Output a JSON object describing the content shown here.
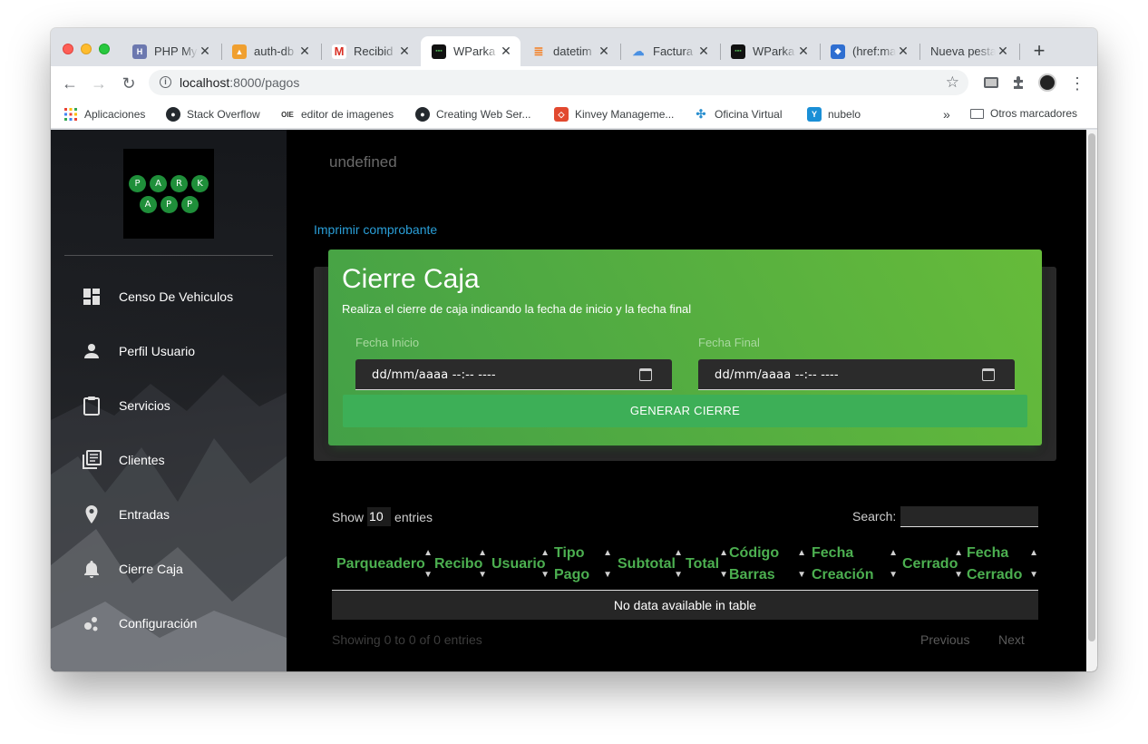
{
  "browser": {
    "tabs": [
      {
        "label": "PHP My",
        "icon": "phpmyadmin-favicon",
        "color": "#6c78af"
      },
      {
        "label": "auth-db",
        "icon": "pma-favicon",
        "color": "#f0a030"
      },
      {
        "label": "Recibid",
        "icon": "gmail-favicon",
        "color": "#d93025"
      },
      {
        "label": "WParka",
        "icon": "wparking-favicon",
        "color": "#1a1a1a"
      },
      {
        "label": "datetim",
        "icon": "stackoverflow-favicon",
        "color": "#f48024"
      },
      {
        "label": "Factura",
        "icon": "cloud-favicon",
        "color": "#4a90e2"
      },
      {
        "label": "WParka",
        "icon": "wparking-favicon",
        "color": "#1a1a1a"
      },
      {
        "label": "(href:ma",
        "icon": "shield-favicon",
        "color": "#2f6fd1"
      },
      {
        "label": "Nueva pesta",
        "icon": "none",
        "color": ""
      }
    ],
    "active_tab_index": 3,
    "new_tab_symbol": "+",
    "url_host": "localhost",
    "url_rest": ":8000/pagos",
    "bookmarks": [
      {
        "label": "Aplicaciones",
        "icon": "apps-grid-icon"
      },
      {
        "label": "Stack Overflow",
        "icon": "github-icon"
      },
      {
        "label": "editor de imagenes",
        "icon": "oie-icon",
        "icon_text": "OIE"
      },
      {
        "label": "Creating Web Ser...",
        "icon": "github-icon"
      },
      {
        "label": "Kinvey Manageme...",
        "icon": "kinvey-icon"
      },
      {
        "label": "Oficina Virtual",
        "icon": "slack-icon"
      },
      {
        "label": "nubelo",
        "icon": "nubelo-icon"
      }
    ],
    "bookmarks_overflow": "»",
    "other_bookmarks": "Otros marcadores"
  },
  "sidebar": {
    "logo_top": [
      "P",
      "A",
      "R",
      "K"
    ],
    "logo_bottom": [
      "A",
      "P",
      "P"
    ],
    "items": [
      {
        "label": "Censo De Vehiculos",
        "icon": "dashboard-icon"
      },
      {
        "label": "Perfil Usuario",
        "icon": "person-icon"
      },
      {
        "label": "Servicios",
        "icon": "clipboard-icon"
      },
      {
        "label": "Clientes",
        "icon": "library-books-icon"
      },
      {
        "label": "Entradas",
        "icon": "location-pin-icon"
      },
      {
        "label": "Cierre Caja",
        "icon": "bell-icon"
      },
      {
        "label": "Configuración",
        "icon": "bubble-chart-icon"
      }
    ]
  },
  "main": {
    "header_text": "undefined",
    "print_link": "Imprimir comprobante",
    "card": {
      "title": "Cierre Caja",
      "subtitle": "Realiza el cierre de caja indicando la fecha de inicio y la fecha final",
      "start_label": "Fecha Inicio",
      "end_label": "Fecha Final",
      "start_value": "dd/mm/aaaa --:-- ----",
      "end_value": "dd/mm/aaaa --:-- ----",
      "button": "GENERAR CIERRE"
    },
    "table": {
      "show_label": "Show",
      "entries_value": "10",
      "entries_label": "entries",
      "search_label": "Search:",
      "columns": [
        "Parqueadero",
        "Recibo",
        "Usuario",
        "Tipo Pago",
        "Subtotal",
        "Total",
        "Código Barras",
        "Fecha Creación",
        "Cerrado",
        "Fecha Cerrado"
      ],
      "empty_message": "No data available in table",
      "info": "Showing 0 to 0 of 0 entries",
      "previous": "Previous",
      "next": "Next"
    }
  },
  "colors": {
    "accent_green": "#4caf50",
    "card_gradient_start": "#43a047",
    "card_gradient_end": "#66bb3a",
    "link_blue": "#2a9fd8"
  }
}
